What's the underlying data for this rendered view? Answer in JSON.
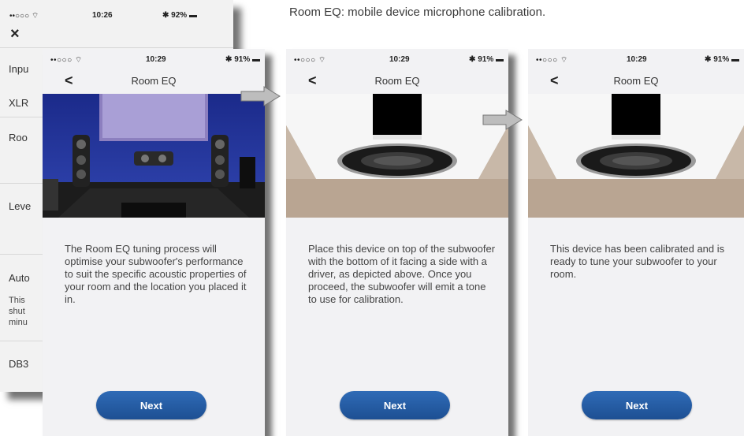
{
  "caption": "Room EQ: mobile device microphone calibration.",
  "background_phone": {
    "status": {
      "signal": "••○○○ ⌔",
      "time": "10:26",
      "battery": "✱ 92% ▬"
    },
    "close_icon": "close-icon",
    "rows": [
      "Inpu",
      "XLR",
      "Roo",
      "Leve",
      "Auto",
      "DB3"
    ],
    "auto_desc": [
      "This",
      "shut",
      "minu"
    ]
  },
  "phones": [
    {
      "status": {
        "signal": "••○○○ ⌔",
        "time": "10:29",
        "battery": "✱ 91% ▬"
      },
      "nav_title": "Room EQ",
      "body": "The Room EQ tuning process will optimise your subwoofer's performance to suit the specific acoustic properties of your room and the location you placed it in.",
      "button": "Next"
    },
    {
      "status": {
        "signal": "••○○○ ⌔",
        "time": "10:29",
        "battery": "✱ 91% ▬"
      },
      "nav_title": "Room EQ",
      "body": "Place this device on top of the subwoofer with the bottom of it facing a side with a driver, as depicted above. Once you proceed, the subwoofer will emit a tone to use for calibration.",
      "button": "Next"
    },
    {
      "status": {
        "signal": "••○○○ ⌔",
        "time": "10:29",
        "battery": "✱ 91% ▬"
      },
      "nav_title": "Room EQ",
      "body": "This device has been calibrated and is ready to tune your subwoofer to your room.",
      "button": "Next"
    }
  ],
  "colors": {
    "accent": "#24579f",
    "wall": "#b9a592",
    "screen_bg": "#f2f2f4"
  }
}
